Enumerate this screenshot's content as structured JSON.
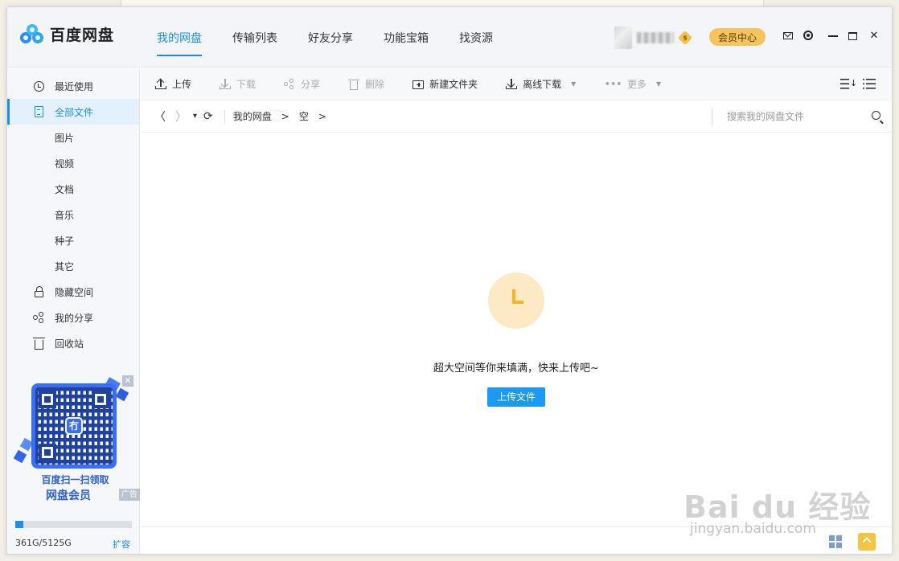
{
  "app": {
    "name": "百度网盘"
  },
  "nav": {
    "tabs": [
      {
        "label": "我的网盘",
        "active": true
      },
      {
        "label": "传输列表"
      },
      {
        "label": "好友分享"
      },
      {
        "label": "功能宝箱"
      },
      {
        "label": "找资源"
      }
    ]
  },
  "header": {
    "member_center": "会员中心",
    "vip_badge": "$"
  },
  "sidebar": {
    "items": [
      {
        "label": "最近使用",
        "icon": "clock-icon"
      },
      {
        "label": "全部文件",
        "icon": "file-icon",
        "active": true
      },
      {
        "label": "图片"
      },
      {
        "label": "视频"
      },
      {
        "label": "文档"
      },
      {
        "label": "音乐"
      },
      {
        "label": "种子"
      },
      {
        "label": "其它"
      },
      {
        "label": "隐藏空间",
        "icon": "lock-icon"
      },
      {
        "label": "我的分享",
        "icon": "share-icon"
      },
      {
        "label": "回收站",
        "icon": "trash-icon"
      }
    ],
    "promo": {
      "close": "✕",
      "qr_center": "冇",
      "line1": "百度扫一扫领取",
      "line2": "网盘会员",
      "ad_tag": "广告"
    },
    "storage": {
      "used_fraction": 0.07,
      "text": "361G/5125G",
      "expand": "扩容"
    }
  },
  "toolbar": {
    "upload": "上传",
    "download": "下载",
    "share": "分享",
    "delete": "删除",
    "new_folder": "新建文件夹",
    "offline_download": "离线下载",
    "more": "更多"
  },
  "pathbar": {
    "back": "〈",
    "forward": "〉",
    "dropdown": "▾",
    "refresh": "⟳",
    "crumbs": [
      "我的网盘",
      "空"
    ],
    "separator": ">"
  },
  "search": {
    "placeholder": "搜索我的网盘文件"
  },
  "empty_state": {
    "message": "超大空间等你来填满，快来上传吧~",
    "upload_button": "上传文件"
  },
  "watermark": {
    "text": "Bai du 经验",
    "sub": "jingyan.baidu.com"
  },
  "colors": {
    "accent": "#1a8df0",
    "member": "#f6c45c",
    "empty_icon": "#f6b426"
  }
}
